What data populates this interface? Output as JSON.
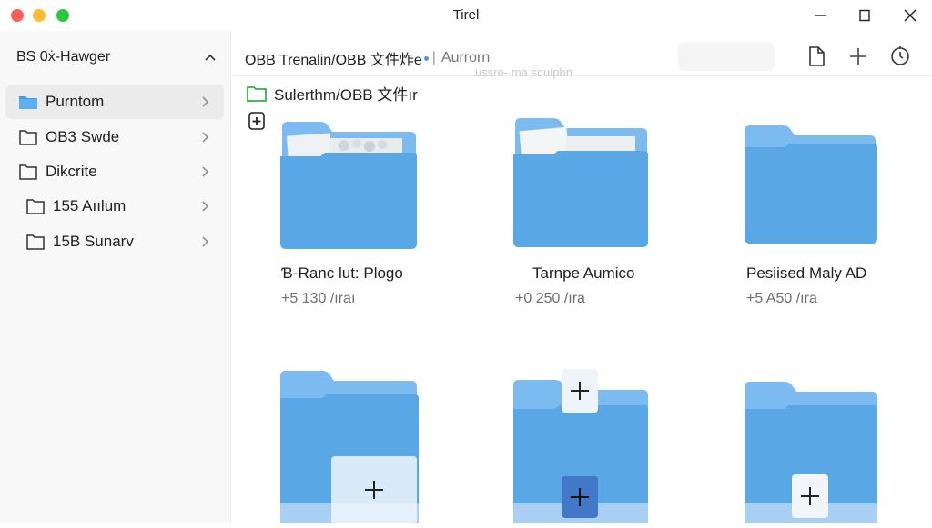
{
  "window": {
    "title": "Tirel"
  },
  "sidebar": {
    "header": "BS 0ẋ-Hawger",
    "items": [
      {
        "label": "Purntom",
        "icon": "folder-filled-icon",
        "active": true
      },
      {
        "label": "OB3 Swde",
        "icon": "folder-outline-icon",
        "active": false
      },
      {
        "label": "Dikcrite",
        "icon": "folder-outline-icon",
        "active": false
      },
      {
        "label": "155 Aıılum",
        "icon": "folder-outline-icon",
        "active": false
      },
      {
        "label": "15B Sunarv",
        "icon": "folder-outline-icon",
        "active": false
      }
    ]
  },
  "toolbar": {
    "breadcrumb": "OBB Trenalin/OBB 文件炸e",
    "separator": "|",
    "location": "Aurrorn",
    "ghost_text": "ussro- ma squiphn"
  },
  "subpath": {
    "label": "Sulerthm/OBB 文件ır"
  },
  "tiles": [
    {
      "name": "Ɓ-Ranc lut: Plogo",
      "meta": "+5 130 /ıraı"
    },
    {
      "name": "Tarnpe Aumico",
      "meta": "+0 250 /ıra"
    },
    {
      "name": "Pesiised Maly AD",
      "meta": "+5 A50 /ıra"
    }
  ],
  "colors": {
    "folder_front": "#5aa7e6",
    "folder_back": "#7bbbef",
    "accent_green": "#2fb14b",
    "sidebar_folder": "#3d9be9"
  }
}
